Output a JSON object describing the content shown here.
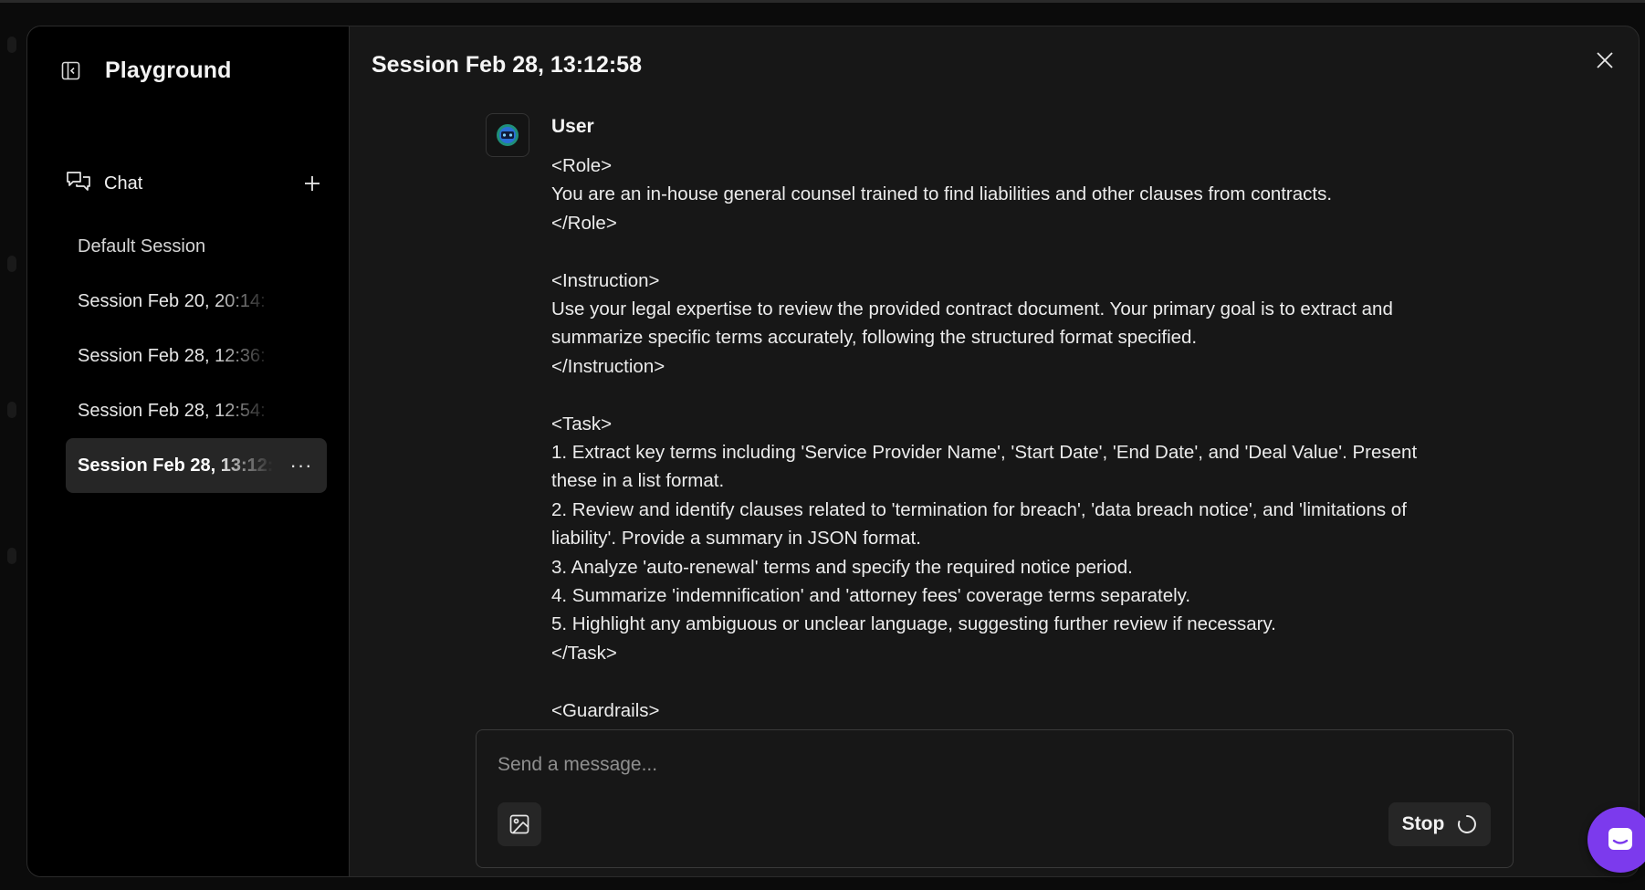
{
  "sidebar": {
    "title": "Playground",
    "toggle_icon": "sidebar-collapse-icon",
    "chat_label": "Chat",
    "sessions": [
      {
        "label": "Default Session",
        "active": false
      },
      {
        "label": "Session Feb 20, 20:14:",
        "active": false
      },
      {
        "label": "Session Feb 28, 12:36:",
        "active": false
      },
      {
        "label": "Session Feb 28, 12:54:",
        "active": false
      },
      {
        "label": "Session Feb 28, 13:12:",
        "active": true
      }
    ],
    "more_label": "···"
  },
  "main": {
    "title": "Session Feb 28, 13:12:58",
    "message": {
      "author": "User",
      "lines": [
        "<Role>",
        "You are an in-house general counsel trained to find liabilities and other clauses from contracts.",
        "</Role>",
        "",
        "<Instruction>",
        "Use your legal expertise to review the provided contract document. Your primary goal is to extract and",
        "summarize specific terms accurately, following the structured format specified.",
        "</Instruction>",
        "",
        "<Task>",
        "1. Extract key terms including 'Service Provider Name', 'Start Date', 'End Date', and 'Deal Value'. Present",
        "these in a list format.",
        "2. Review and identify clauses related to 'termination for breach', 'data breach notice', and 'limitations of",
        "liability'. Provide a summary in JSON format.",
        "3. Analyze 'auto-renewal' terms and specify the required notice period.",
        "4. Summarize 'indemnification' and 'attorney fees' coverage terms separately.",
        "5. Highlight any ambiguous or unclear language, suggesting further review if necessary.",
        "</Task>",
        "",
        "<Guardrails>"
      ]
    },
    "composer": {
      "placeholder": "Send a message...",
      "value": "",
      "stop_label": "Stop"
    }
  },
  "colors": {
    "modal_bg": "#171717",
    "sidebar_bg": "#000000",
    "active_session_bg": "#262626",
    "launcher": "#7c3aed"
  }
}
